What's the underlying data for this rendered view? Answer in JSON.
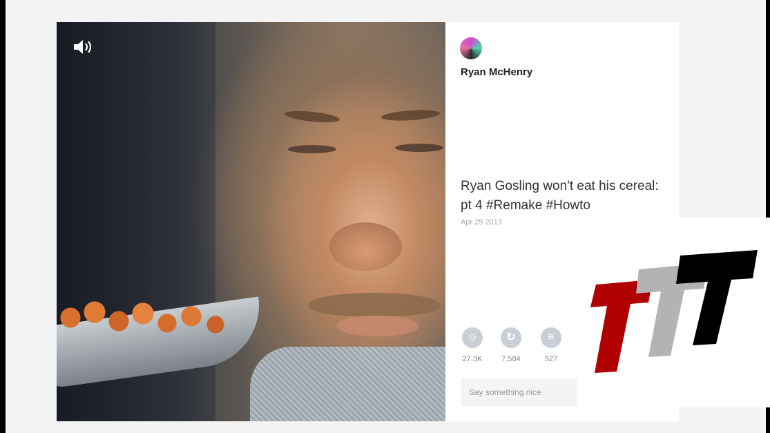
{
  "post": {
    "username": "Ryan McHenry",
    "caption": "Ryan Gosling won't eat his cereal: pt 4 #Remake #Howto",
    "date": "Apr 25 2013",
    "stats": {
      "likes": "27.3K",
      "revines": "7,584",
      "comments": "527"
    },
    "comment_placeholder": "Say something nice"
  },
  "icons": {
    "sound": "speaker-icon",
    "like": "smiley-icon",
    "revine": "revine-icon",
    "comment": "comment-bubble-icon"
  },
  "logo": {
    "colors": [
      "#b00000",
      "#b3b3b3",
      "#000000"
    ]
  }
}
